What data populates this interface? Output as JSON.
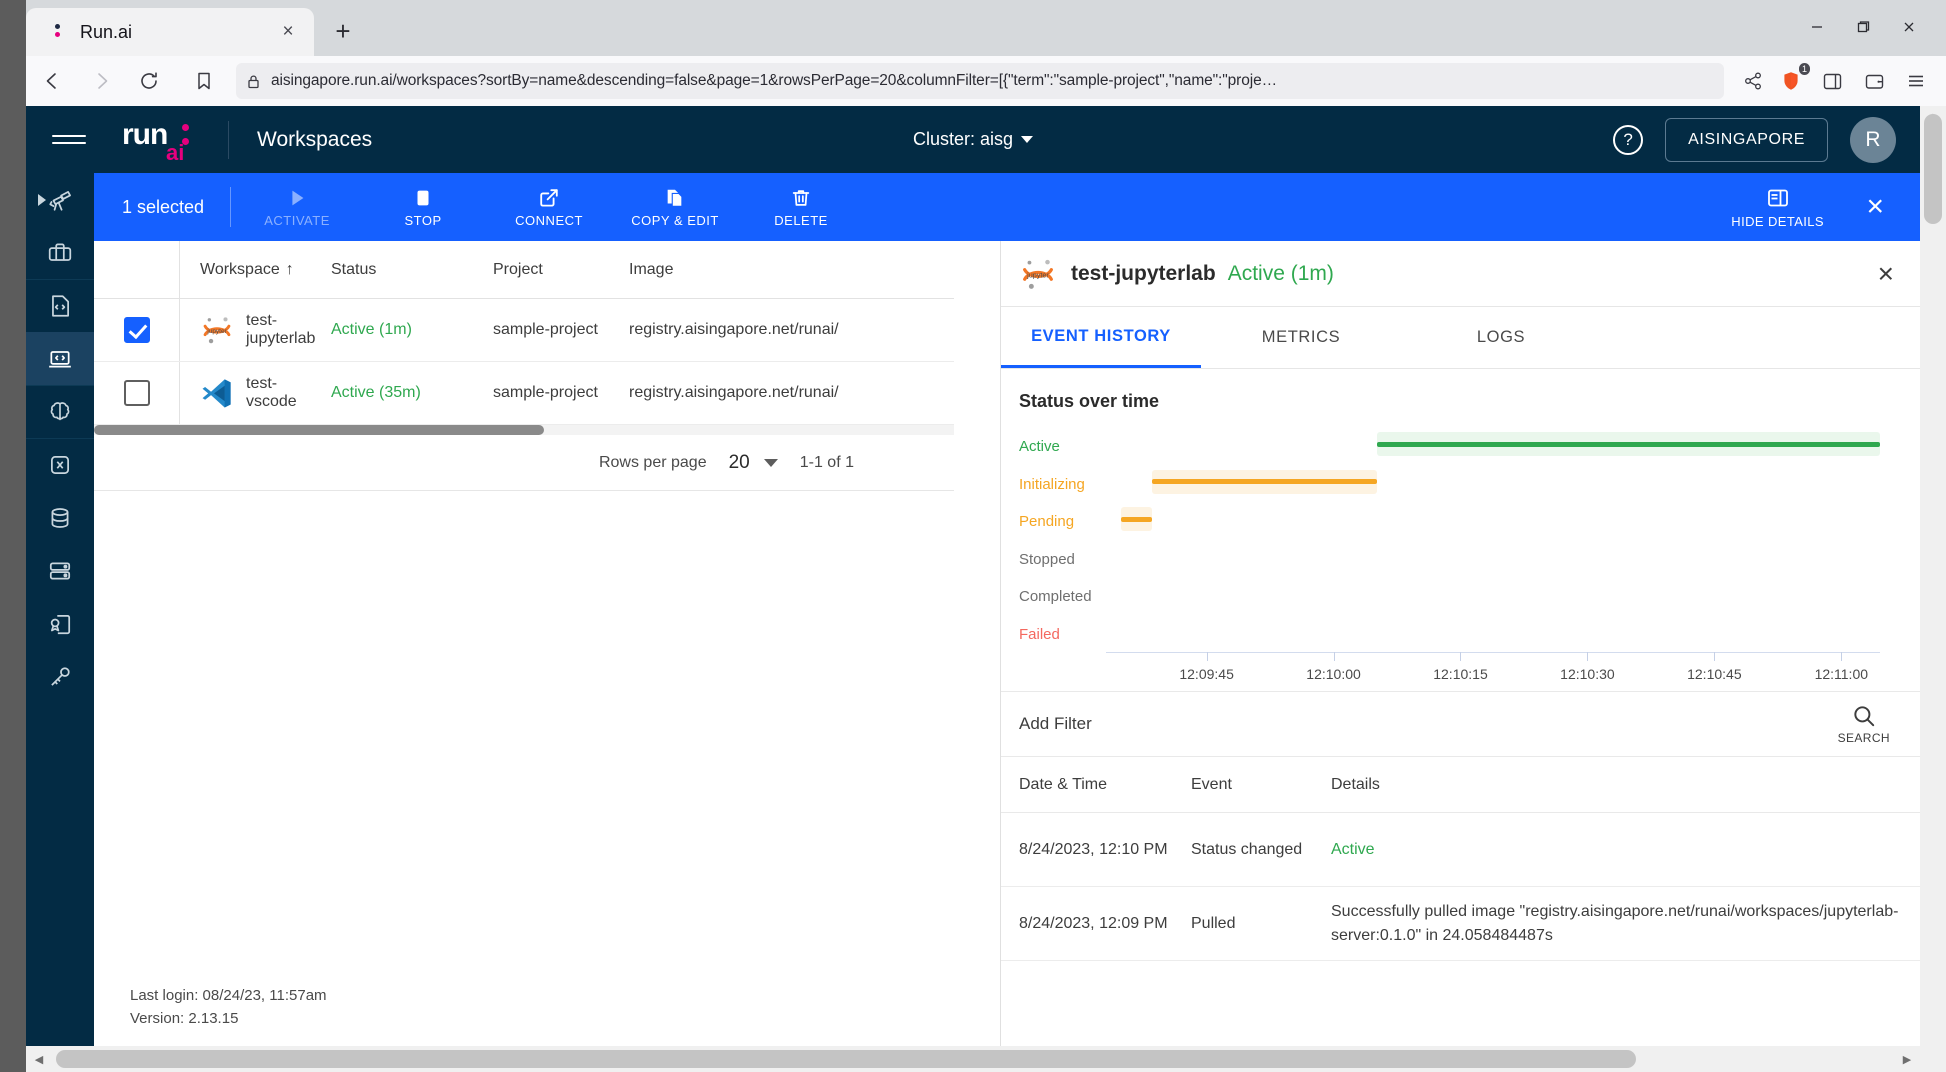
{
  "browser": {
    "tab": {
      "title": "Run.ai",
      "close_label": "×",
      "favicon": "runai-favicon"
    },
    "newtab_label": "+",
    "window_controls": {
      "minimize": "—",
      "maximize": "❐",
      "close": "✕"
    },
    "nav": {
      "back": "◁",
      "forward": "▷",
      "reload": "⟳",
      "bookmark": "bookmark-icon"
    },
    "url": "aisingapore.run.ai/workspaces?sortBy=name&descending=false&page=1&rowsPerPage=20&columnFilter=[{\"term\":\"sample-project\",\"name\":\"proje…",
    "lock_icon": "lock-icon",
    "share_icon": "share-icon",
    "shield_icon": "brave-shield-icon",
    "shield_count": "1",
    "sidebar_icon": "sidebar-toggle-icon",
    "wallet_icon": "wallet-icon",
    "menu_icon": "hamburger-menu-icon"
  },
  "topnav": {
    "menu_icon": "hamburger-icon",
    "logo_run": "run",
    "logo_ai": "ai",
    "title": "Workspaces",
    "cluster_label": "Cluster: aisg",
    "help_icon": "help-circle-icon",
    "org_button": "AISINGAPORE",
    "avatar_initial": "R"
  },
  "rail": {
    "items": [
      {
        "name": "overview",
        "icon": "telescope-icon",
        "active": false
      },
      {
        "name": "workloads",
        "icon": "briefcase-icon",
        "active": false
      },
      {
        "name": "trainings",
        "icon": "code-file-icon",
        "active": false
      },
      {
        "name": "workspaces",
        "icon": "laptop-code-icon",
        "active": true
      },
      {
        "name": "deployments",
        "icon": "brain-icon",
        "active": false
      },
      {
        "name": "experiments",
        "icon": "hexagon-x-icon",
        "active": false
      },
      {
        "name": "data-sources",
        "icon": "database-icon",
        "active": false
      },
      {
        "name": "compute-resources",
        "icon": "server-icon",
        "active": false
      },
      {
        "name": "templates",
        "icon": "certificate-icon",
        "active": false
      },
      {
        "name": "credentials",
        "icon": "key-icon",
        "active": false
      }
    ]
  },
  "actionbar": {
    "selected_text": "1 selected",
    "actions": [
      {
        "label": "ACTIVATE",
        "icon": "play-icon",
        "disabled": true
      },
      {
        "label": "STOP",
        "icon": "stop-square-icon",
        "disabled": false
      },
      {
        "label": "CONNECT",
        "icon": "external-link-icon",
        "disabled": false
      },
      {
        "label": "COPY & EDIT",
        "icon": "copy-icon",
        "disabled": false
      },
      {
        "label": "DELETE",
        "icon": "trash-icon",
        "disabled": false
      }
    ],
    "hide_details_label": "HIDE DETAILS",
    "hide_details_icon": "panel-collapse-icon",
    "close_label": "×"
  },
  "table": {
    "columns": [
      {
        "key": "workspace",
        "label": "Workspace",
        "sort": "↑"
      },
      {
        "key": "status",
        "label": "Status"
      },
      {
        "key": "project",
        "label": "Project"
      },
      {
        "key": "image",
        "label": "Image"
      }
    ],
    "rows": [
      {
        "checked": true,
        "icon": "jupyter-icon",
        "workspace": "test-jupyterlab",
        "status": "Active (1m)",
        "project": "sample-project",
        "image": "registry.aisingapore.net/runai/"
      },
      {
        "checked": false,
        "icon": "vscode-icon",
        "workspace": "test-vscode",
        "status": "Active (35m)",
        "project": "sample-project",
        "image": "registry.aisingapore.net/runai/"
      }
    ],
    "pager": {
      "rows_per_page_label": "Rows per page",
      "rows_per_page_value": "20",
      "range_label": "1-1 of 1"
    }
  },
  "footer": {
    "last_login": "Last login: 08/24/23, 11:57am",
    "version": "Version: 2.13.15"
  },
  "detail": {
    "icon": "jupyter-icon",
    "title": "test-jupyterlab",
    "status": "Active (1m)",
    "close_label": "×",
    "tabs": [
      {
        "label": "EVENT HISTORY",
        "active": true
      },
      {
        "label": "METRICS",
        "active": false
      },
      {
        "label": "LOGS",
        "active": false
      }
    ],
    "filter": {
      "add_filter_label": "Add Filter",
      "search_label": "SEARCH",
      "search_icon": "search-icon"
    },
    "events": {
      "columns": [
        "Date & Time",
        "Event",
        "Details"
      ],
      "rows": [
        {
          "datetime": "8/24/2023, 12:10 PM",
          "event": "Status changed",
          "details": "Active",
          "details_color": "#2fa84f"
        },
        {
          "datetime": "8/24/2023, 12:09 PM",
          "event": "Pulled",
          "details": "Successfully pulled image \"registry.aisingapore.net/runai/workspaces/jupyterlab-server:0.1.0\" in 24.058484487s",
          "details_color": "#3d3d3d"
        }
      ]
    }
  },
  "chart_data": {
    "type": "timeline",
    "title": "Status over time",
    "xlabel": "",
    "ylabel": "",
    "categories": [
      "Active",
      "Initializing",
      "Pending",
      "Stopped",
      "Completed",
      "Failed"
    ],
    "category_colors": {
      "Active": "#2fa84f",
      "Initializing": "#f5a623",
      "Pending": "#f5a623",
      "Stopped": "#7d7d7d",
      "Completed": "#7d7d7d",
      "Failed": "#f4685f"
    },
    "xticks": [
      "12:09:45",
      "12:10:00",
      "12:10:15",
      "12:10:30",
      "12:10:45",
      "12:11:00"
    ],
    "xlim": [
      "12:09:36",
      "12:11:08"
    ],
    "grid": false,
    "legend": "none",
    "series": [
      {
        "name": "Pending",
        "start": "12:09:40",
        "end": "12:09:44",
        "color": "#f5a623",
        "start_pct": 2,
        "end_pct": 6
      },
      {
        "name": "Initializing",
        "start": "12:09:44",
        "end": "12:10:11",
        "color": "#f5a623",
        "start_pct": 6,
        "end_pct": 35
      },
      {
        "name": "Active",
        "start": "12:10:11",
        "end": "12:11:08",
        "color": "#2fa84f",
        "start_pct": 35,
        "end_pct": 100
      }
    ]
  }
}
